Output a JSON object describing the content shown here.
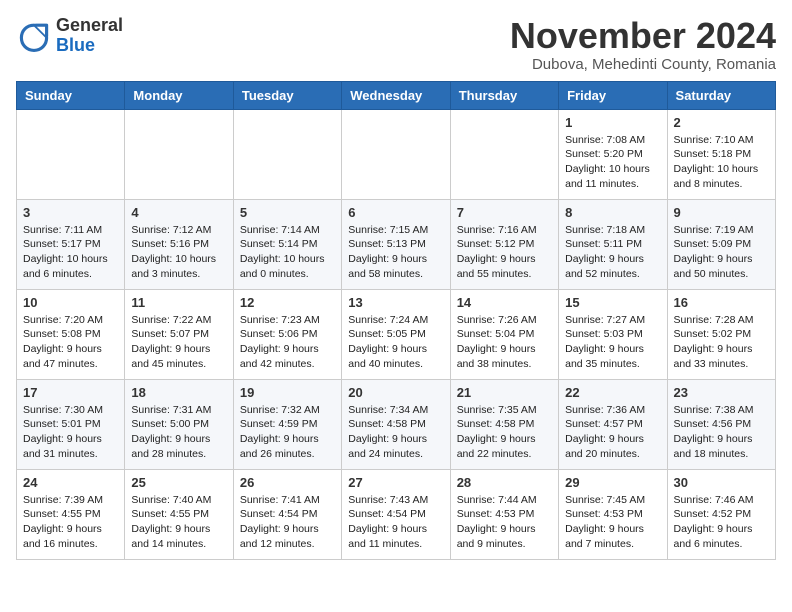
{
  "header": {
    "logo_general": "General",
    "logo_blue": "Blue",
    "month_title": "November 2024",
    "location": "Dubova, Mehedinti County, Romania"
  },
  "weekdays": [
    "Sunday",
    "Monday",
    "Tuesday",
    "Wednesday",
    "Thursday",
    "Friday",
    "Saturday"
  ],
  "weeks": [
    [
      {
        "day": "",
        "info": ""
      },
      {
        "day": "",
        "info": ""
      },
      {
        "day": "",
        "info": ""
      },
      {
        "day": "",
        "info": ""
      },
      {
        "day": "",
        "info": ""
      },
      {
        "day": "1",
        "info": "Sunrise: 7:08 AM\nSunset: 5:20 PM\nDaylight: 10 hours and 11 minutes."
      },
      {
        "day": "2",
        "info": "Sunrise: 7:10 AM\nSunset: 5:18 PM\nDaylight: 10 hours and 8 minutes."
      }
    ],
    [
      {
        "day": "3",
        "info": "Sunrise: 7:11 AM\nSunset: 5:17 PM\nDaylight: 10 hours and 6 minutes."
      },
      {
        "day": "4",
        "info": "Sunrise: 7:12 AM\nSunset: 5:16 PM\nDaylight: 10 hours and 3 minutes."
      },
      {
        "day": "5",
        "info": "Sunrise: 7:14 AM\nSunset: 5:14 PM\nDaylight: 10 hours and 0 minutes."
      },
      {
        "day": "6",
        "info": "Sunrise: 7:15 AM\nSunset: 5:13 PM\nDaylight: 9 hours and 58 minutes."
      },
      {
        "day": "7",
        "info": "Sunrise: 7:16 AM\nSunset: 5:12 PM\nDaylight: 9 hours and 55 minutes."
      },
      {
        "day": "8",
        "info": "Sunrise: 7:18 AM\nSunset: 5:11 PM\nDaylight: 9 hours and 52 minutes."
      },
      {
        "day": "9",
        "info": "Sunrise: 7:19 AM\nSunset: 5:09 PM\nDaylight: 9 hours and 50 minutes."
      }
    ],
    [
      {
        "day": "10",
        "info": "Sunrise: 7:20 AM\nSunset: 5:08 PM\nDaylight: 9 hours and 47 minutes."
      },
      {
        "day": "11",
        "info": "Sunrise: 7:22 AM\nSunset: 5:07 PM\nDaylight: 9 hours and 45 minutes."
      },
      {
        "day": "12",
        "info": "Sunrise: 7:23 AM\nSunset: 5:06 PM\nDaylight: 9 hours and 42 minutes."
      },
      {
        "day": "13",
        "info": "Sunrise: 7:24 AM\nSunset: 5:05 PM\nDaylight: 9 hours and 40 minutes."
      },
      {
        "day": "14",
        "info": "Sunrise: 7:26 AM\nSunset: 5:04 PM\nDaylight: 9 hours and 38 minutes."
      },
      {
        "day": "15",
        "info": "Sunrise: 7:27 AM\nSunset: 5:03 PM\nDaylight: 9 hours and 35 minutes."
      },
      {
        "day": "16",
        "info": "Sunrise: 7:28 AM\nSunset: 5:02 PM\nDaylight: 9 hours and 33 minutes."
      }
    ],
    [
      {
        "day": "17",
        "info": "Sunrise: 7:30 AM\nSunset: 5:01 PM\nDaylight: 9 hours and 31 minutes."
      },
      {
        "day": "18",
        "info": "Sunrise: 7:31 AM\nSunset: 5:00 PM\nDaylight: 9 hours and 28 minutes."
      },
      {
        "day": "19",
        "info": "Sunrise: 7:32 AM\nSunset: 4:59 PM\nDaylight: 9 hours and 26 minutes."
      },
      {
        "day": "20",
        "info": "Sunrise: 7:34 AM\nSunset: 4:58 PM\nDaylight: 9 hours and 24 minutes."
      },
      {
        "day": "21",
        "info": "Sunrise: 7:35 AM\nSunset: 4:58 PM\nDaylight: 9 hours and 22 minutes."
      },
      {
        "day": "22",
        "info": "Sunrise: 7:36 AM\nSunset: 4:57 PM\nDaylight: 9 hours and 20 minutes."
      },
      {
        "day": "23",
        "info": "Sunrise: 7:38 AM\nSunset: 4:56 PM\nDaylight: 9 hours and 18 minutes."
      }
    ],
    [
      {
        "day": "24",
        "info": "Sunrise: 7:39 AM\nSunset: 4:55 PM\nDaylight: 9 hours and 16 minutes."
      },
      {
        "day": "25",
        "info": "Sunrise: 7:40 AM\nSunset: 4:55 PM\nDaylight: 9 hours and 14 minutes."
      },
      {
        "day": "26",
        "info": "Sunrise: 7:41 AM\nSunset: 4:54 PM\nDaylight: 9 hours and 12 minutes."
      },
      {
        "day": "27",
        "info": "Sunrise: 7:43 AM\nSunset: 4:54 PM\nDaylight: 9 hours and 11 minutes."
      },
      {
        "day": "28",
        "info": "Sunrise: 7:44 AM\nSunset: 4:53 PM\nDaylight: 9 hours and 9 minutes."
      },
      {
        "day": "29",
        "info": "Sunrise: 7:45 AM\nSunset: 4:53 PM\nDaylight: 9 hours and 7 minutes."
      },
      {
        "day": "30",
        "info": "Sunrise: 7:46 AM\nSunset: 4:52 PM\nDaylight: 9 hours and 6 minutes."
      }
    ]
  ]
}
